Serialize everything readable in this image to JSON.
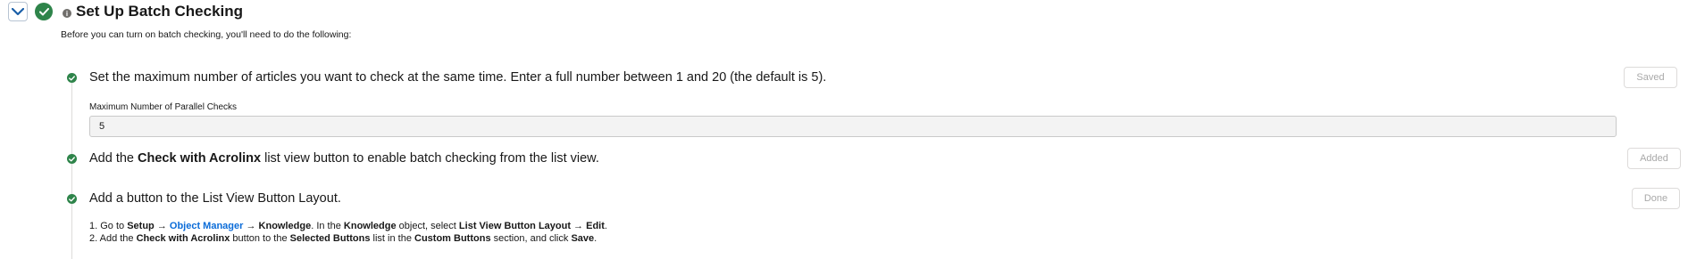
{
  "header": {
    "title": "Set Up Batch Checking",
    "intro": "Before you can turn on batch checking, you'll need to do the following:"
  },
  "steps": [
    {
      "text_parts": [
        "Set the maximum number of articles you want to check at the same time. Enter a full number between 1 and 20 (the default is 5)."
      ],
      "status": "Saved",
      "field_label": "Maximum Number of Parallel Checks",
      "field_value": "5"
    },
    {
      "text_parts": [
        "Add the ",
        "Check with Acrolinx",
        " list view button to enable batch checking from the list view."
      ],
      "status": "Added"
    },
    {
      "text_parts": [
        "Add a button to the List View Button Layout."
      ],
      "status": "Done",
      "instructions": {
        "line1": [
          "1. Go to ",
          "Setup",
          " → ",
          "Object Manager",
          " → ",
          "Knowledge",
          ". In the ",
          "Knowledge",
          " object, select ",
          "List View Button Layout → Edit",
          "."
        ],
        "line2": [
          "2. Add the ",
          "Check with Acrolinx",
          " button to the ",
          "Selected Buttons",
          " list in the ",
          "Custom Buttons",
          " section, and click ",
          "Save",
          "."
        ]
      }
    }
  ],
  "icons": {
    "collapse": "chevron-down-icon",
    "complete": "check-icon",
    "info": "info-icon"
  },
  "colors": {
    "success": "#2e844a",
    "link": "#0b6cd8",
    "collapse_border": "#b8c4d3"
  }
}
